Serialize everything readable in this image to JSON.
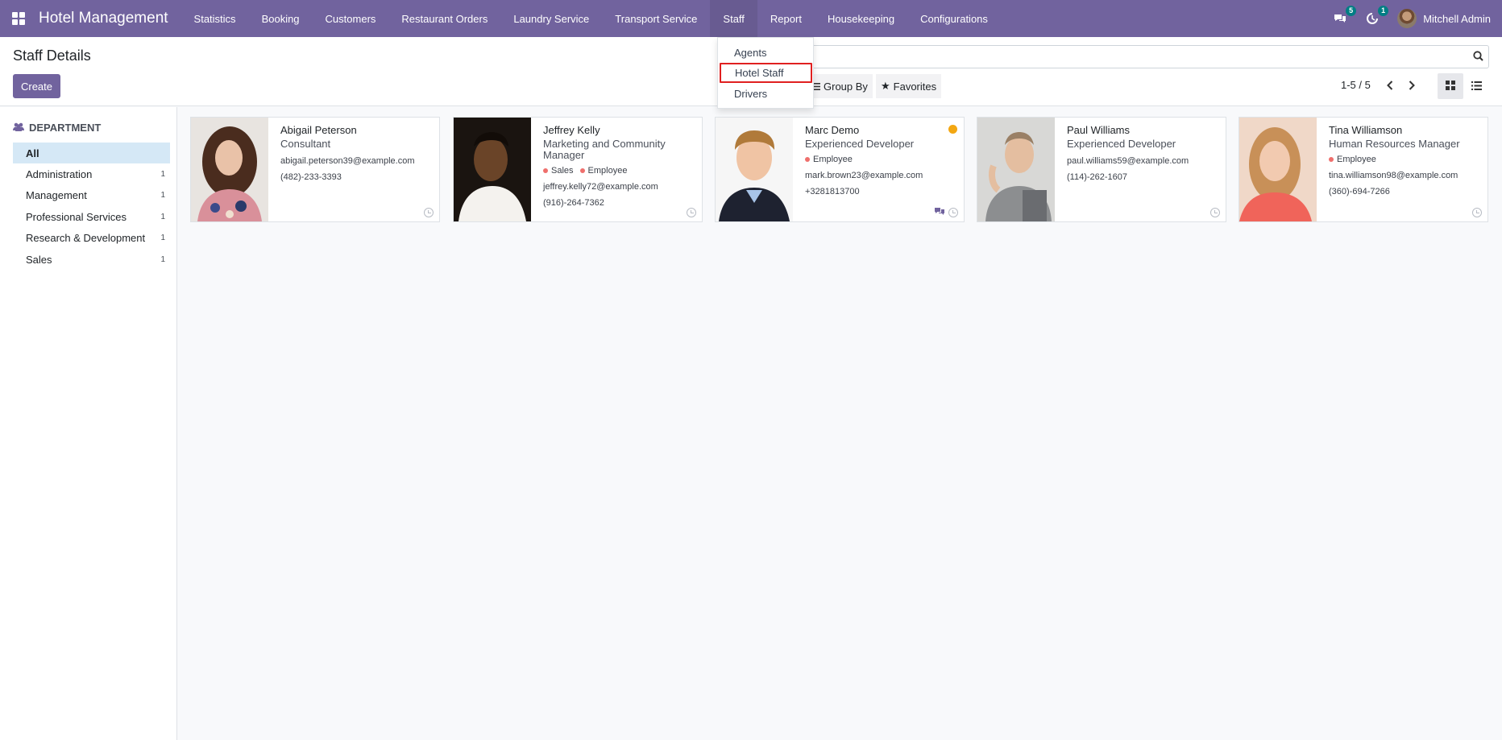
{
  "navbar": {
    "brand": "Hotel Management",
    "menu": [
      "Statistics",
      "Booking",
      "Customers",
      "Restaurant Orders",
      "Laundry Service",
      "Transport Service",
      "Staff",
      "Report",
      "Housekeeping",
      "Configurations"
    ],
    "active_menu": "Staff",
    "messages_count": "5",
    "activities_count": "1",
    "user_name": "Mitchell Admin",
    "accent_color": "#71639e"
  },
  "staff_menu": {
    "items": [
      "Agents",
      "Hotel Staff",
      "Drivers"
    ],
    "highlighted": "Hotel Staff"
  },
  "control": {
    "title": "Staff Details",
    "create_label": "Create",
    "search_value": "",
    "group_by_label": "Group By",
    "favorites_label": "Favorites",
    "pager": "1-5 / 5"
  },
  "sidebar": {
    "heading": "DEPARTMENT",
    "items": [
      {
        "label": "All",
        "count": ""
      },
      {
        "label": "Administration",
        "count": "1"
      },
      {
        "label": "Management",
        "count": "1"
      },
      {
        "label": "Professional Services",
        "count": "1"
      },
      {
        "label": "Research & Development",
        "count": "1"
      },
      {
        "label": "Sales",
        "count": "1"
      }
    ]
  },
  "employees": [
    {
      "name": "Abigail Peterson",
      "job": "Consultant",
      "tags": [],
      "email": "abigail.peterson39@example.com",
      "phone": "(482)-233-3393"
    },
    {
      "name": "Jeffrey Kelly",
      "job": "Marketing and Community Manager",
      "tags": [
        "Sales",
        "Employee"
      ],
      "email": "jeffrey.kelly72@example.com",
      "phone": "(916)-264-7362"
    },
    {
      "name": "Marc Demo",
      "job": "Experienced Developer",
      "tags": [
        "Employee"
      ],
      "email": "mark.brown23@example.com",
      "phone": "+3281813700"
    },
    {
      "name": "Paul Williams",
      "job": "Experienced Developer",
      "tags": [],
      "email": "paul.williams59@example.com",
      "phone": "(114)-262-1607"
    },
    {
      "name": "Tina Williamson",
      "job": "Human Resources Manager",
      "tags": [
        "Employee"
      ],
      "email": "tina.williamson98@example.com",
      "phone": "(360)-694-7266"
    }
  ]
}
